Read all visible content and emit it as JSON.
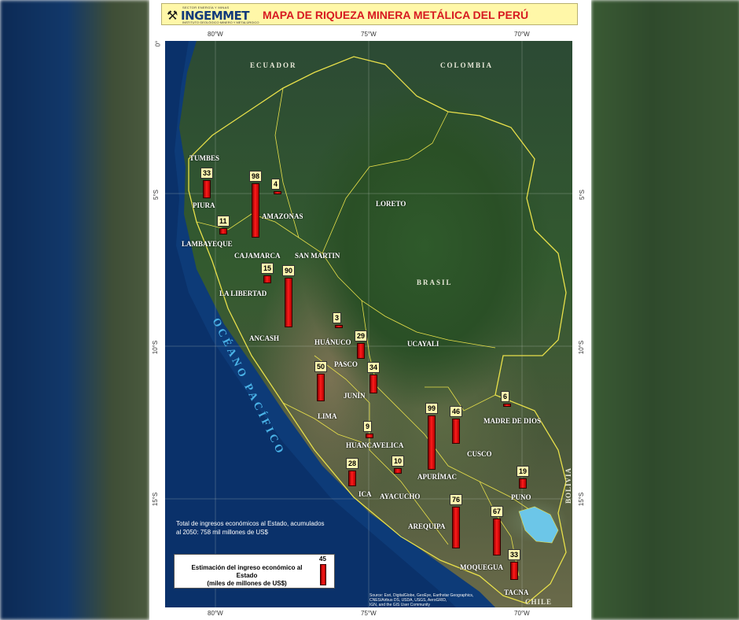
{
  "header": {
    "logo_top": "SECTOR ENERGÍA Y MINAS",
    "logo_name": "INGEMMET",
    "logo_sub": "INSTITUTO GEOLÓGICO MINERO Y METALÚRGICO",
    "title": "MAPA DE RIQUEZA MINERA METÁLICA DEL PERÚ"
  },
  "coordinates": {
    "lon_top": [
      "80°W",
      "75°W",
      "70°W"
    ],
    "lon_bottom": [
      "80°W",
      "75°W",
      "70°W"
    ],
    "lat": [
      "0°",
      "5°S",
      "10°S",
      "15°S"
    ]
  },
  "countries": {
    "ecuador": "ECUADOR",
    "colombia": "COLOMBIA",
    "brasil": "BRASIL",
    "bolivia": "BOLIVIA",
    "chile": "CHILE"
  },
  "ocean_label": "OCÉANO PACÍFICO",
  "regions": {
    "tumbes": "TUMBES",
    "piura": "PIURA",
    "lambayeque": "LAMBAYEQUE",
    "cajamarca": "CAJAMARCA",
    "amazonas": "AMAZONAS",
    "san_martin": "SAN MARTIN",
    "loreto": "LORETO",
    "la_libertad": "LA LIBERTAD",
    "ancash": "ANCASH",
    "huanuco": "HUÁNUCO",
    "pasco": "PASCO",
    "ucayali": "UCAYALI",
    "junin": "JUNÍN",
    "lima": "LIMA",
    "madre_de_dios": "MADRE DE DIOS",
    "huancavelica": "HUANCAVELICA",
    "cusco": "CUSCO",
    "ica": "ICA",
    "ayacucho": "AYACUCHO",
    "apurimac": "APURÍMAC",
    "puno": "PUNO",
    "arequipa": "AREQUIPA",
    "moquegua": "MOQUEGUA",
    "tacna": "TACNA"
  },
  "bars": [
    {
      "region": "Tumbes-Piura",
      "value": 33
    },
    {
      "region": "Cajamarca north",
      "value": 98
    },
    {
      "region": "Amazonas",
      "value": 4
    },
    {
      "region": "Lambayeque",
      "value": 11
    },
    {
      "region": "Cajamarca",
      "value": 15
    },
    {
      "region": "La Libertad",
      "value": 90
    },
    {
      "region": "Huánuco",
      "value": 3
    },
    {
      "region": "Pasco",
      "value": 29
    },
    {
      "region": "Junín",
      "value": 34
    },
    {
      "region": "Lima",
      "value": 50
    },
    {
      "region": "Madre de Dios",
      "value": 6
    },
    {
      "region": "Apurímac",
      "value": 99
    },
    {
      "region": "Cusco",
      "value": 46
    },
    {
      "region": "Huancavelica",
      "value": 9
    },
    {
      "region": "Ica",
      "value": 28
    },
    {
      "region": "Ayacucho",
      "value": 10
    },
    {
      "region": "Puno",
      "value": 19
    },
    {
      "region": "Arequipa",
      "value": 76
    },
    {
      "region": "Moquegua",
      "value": 67
    },
    {
      "region": "Tacna",
      "value": 33
    }
  ],
  "info": {
    "line1": "Total de ingresos económicos al Estado, acumulados",
    "line2": "al 2050: 758 mil millones de US$"
  },
  "legend": {
    "value": "45",
    "text1": "Estimación del ingreso económico al Estado",
    "text2": "(miles de millones de US$)"
  },
  "source": {
    "line1": "Source: Esri, DigitalGlobe, GeoEye, Earthstar Geographics, CNES/Airbus DS, USDA, USGS, AeroGRID,",
    "line2": "IGN, and the GIS User Community"
  }
}
